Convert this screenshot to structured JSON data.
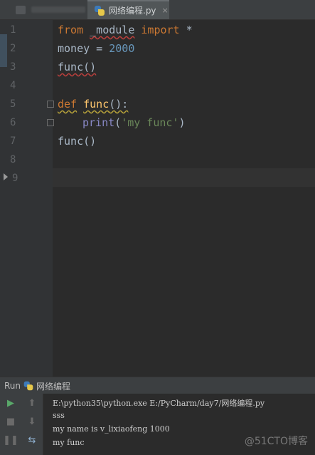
{
  "tab": {
    "active_label": "网络编程.py",
    "close_glyph": "×"
  },
  "editor": {
    "line_numbers": [
      "1",
      "2",
      "3",
      "4",
      "5",
      "6",
      "7",
      "8",
      "9"
    ],
    "lines": {
      "l1": {
        "from": "from",
        "module": "_module",
        "import": "import",
        "star": " *"
      },
      "l2": {
        "var": "money",
        "eq": " = ",
        "num": "2000"
      },
      "l3": {
        "call": "func()"
      },
      "l5": {
        "def": "def",
        "name": "func",
        "rest": "():"
      },
      "l6": {
        "print": "print",
        "open": "(",
        "str": "'my func'",
        "close": ")"
      },
      "l7": {
        "call": "func()"
      }
    }
  },
  "run": {
    "label": "Run",
    "config_name": "网络编程",
    "console_lines": [
      "E:\\python35\\python.exe E:/PyCharm/day7/网络编程.py",
      "sss",
      "my name is v_lixiaofeng 1000",
      "my func"
    ]
  },
  "watermark": "@51CTO博客",
  "colors": {
    "keyword": "#cc7832",
    "number": "#6897bb",
    "string": "#6a8759",
    "run_green": "#59a869"
  }
}
